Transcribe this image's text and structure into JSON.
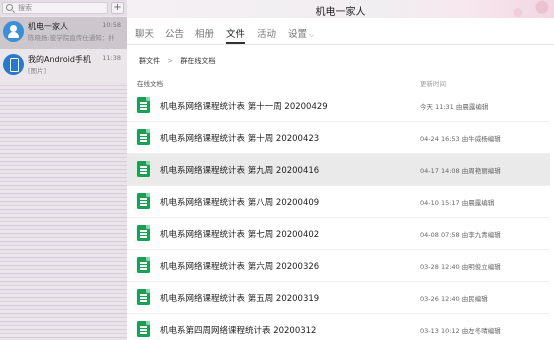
{
  "window": {
    "title": "机电一家人"
  },
  "sidebar": {
    "search_placeholder": "搜索",
    "add_label": "+",
    "chats": [
      {
        "name": "机电一家人",
        "time": "10:58",
        "preview": "陈晓扬:彼学院直传仕通知：扑",
        "avatar": "group-icon",
        "active": true
      },
      {
        "name": "我的Android手机",
        "time": "11:38",
        "preview": "[图片]",
        "avatar": "phone-icon",
        "active": false
      }
    ]
  },
  "tabs": [
    {
      "label": "聊天"
    },
    {
      "label": "公告"
    },
    {
      "label": "相册"
    },
    {
      "label": "文件",
      "active": true
    },
    {
      "label": "活动"
    },
    {
      "label": "设置",
      "has_dropdown": true
    }
  ],
  "breadcrumb": {
    "root": "群文件",
    "separator": ">",
    "current": "群在线文档"
  },
  "list": {
    "header_name": "在线文档",
    "header_time": "更新时间",
    "files": [
      {
        "name": "机电系网络课程统计表 第十一周 20200429",
        "meta": "今天 11:31  由晨露编辑"
      },
      {
        "name": "机电系网络课程统计表 第十周 20200423",
        "meta": "04-24 16:53  由牛威杨编辑"
      },
      {
        "name": "机电系网络课程统计表 第九周 20200416",
        "meta": "04-17 14:08  由周艳丽编辑",
        "selected": true
      },
      {
        "name": "机电系网络课程统计表 第八周 20200409",
        "meta": "04-10 15:17  由晨露编辑"
      },
      {
        "name": "机电系网络课程统计表 第七周 20200402",
        "meta": "04-08 07:58  由李九青编辑"
      },
      {
        "name": "机电系网络课程统计表 第六周 20200326",
        "meta": "03-28 12:40  由明俊立编辑"
      },
      {
        "name": "机电系网络课程统计表 第五周 20200319",
        "meta": "03-26 12:40  由民编辑"
      },
      {
        "name": "机电系第四周网络课程统计表 20200312",
        "meta": "03-13 10:12  由左冬晴编辑"
      }
    ]
  },
  "colors": {
    "accent_green": "#1e9d55",
    "sidebar_bg": "#ebe6ea",
    "active_tab_underline": "#333333"
  }
}
